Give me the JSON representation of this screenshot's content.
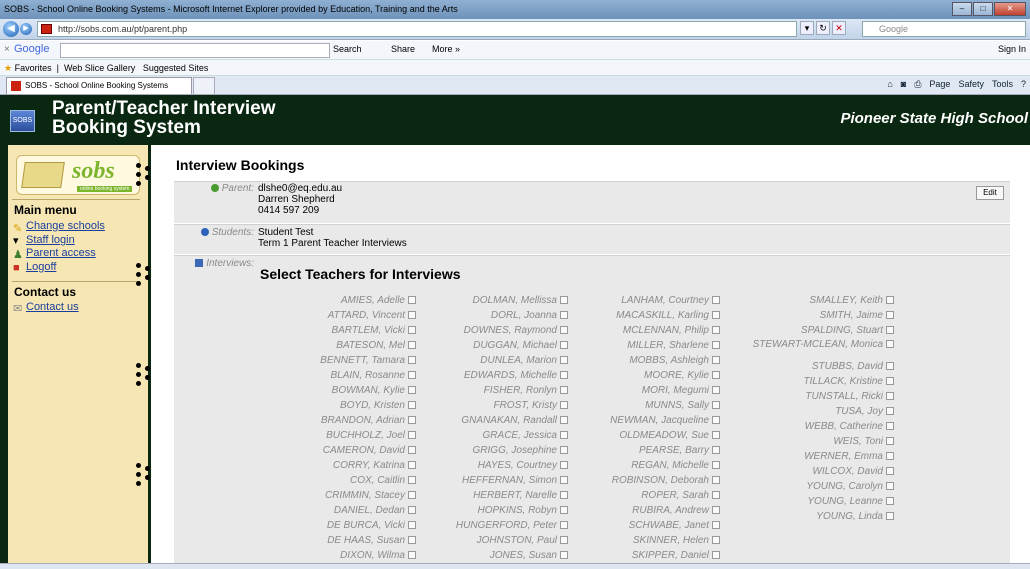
{
  "browser": {
    "window_title": "SOBS - School Online Booking Systems - Microsoft Internet Explorer provided by Education, Training and the Arts",
    "url": "http://sobs.com.au/pt/parent.php",
    "search_placeholder": "Google",
    "google_bar": {
      "brand": "Google",
      "search": "Search",
      "share": "Share",
      "more": "More »",
      "sign_in": "Sign In"
    },
    "favorites": {
      "label": "Favorites",
      "web_slice": "Web Slice Gallery",
      "suggested": "Suggested Sites"
    },
    "tab_title": "SOBS - School Online Booking Systems",
    "commands": [
      "Page",
      "Safety",
      "Tools"
    ]
  },
  "header": {
    "title_line1": "Parent/Teacher Interview",
    "title_line2": "Booking System",
    "school": "Pioneer State High School",
    "logo_text": "SOBS"
  },
  "sidebar": {
    "brand": "sobs",
    "brand_tag": "online booking system",
    "main_menu_heading": "Main menu",
    "main_menu": [
      "Change schools",
      "Staff login",
      "Parent access",
      "Logoff"
    ],
    "contact_heading": "Contact us",
    "contact_links": [
      "Contact us"
    ]
  },
  "main": {
    "page_title": "Interview Bookings",
    "parent": {
      "label": "Parent:",
      "email": "dlshe0@eq.edu.au",
      "name": "Darren Shepherd",
      "phone": "0414 597 209",
      "edit_label": "Edit"
    },
    "students": {
      "label": "Students:",
      "name": "Student Test",
      "event": "Term 1 Parent Teacher Interviews"
    },
    "interviews": {
      "label": "Interviews:",
      "heading": "Select Teachers for Interviews"
    },
    "teacher_columns": [
      [
        "AMIES, Adelle",
        "ATTARD, Vincent",
        "BARTLEM, Vicki",
        "BATESON, Mel",
        "BENNETT, Tamara",
        "BLAIN, Rosanne",
        "BOWMAN, Kylie",
        "BOYD, Kristen",
        "BRANDON, Adrian",
        "BUCHHOLZ, Joel",
        "CAMERON, David",
        "CORRY, Katrina",
        "COX, Caitlin",
        "CRIMMIN, Stacey",
        "DANIEL, Dedan",
        "DE BURCA, Vicki",
        "DE HAAS, Susan",
        "DIXON, Wilma"
      ],
      [
        "DOLMAN, Mellissa",
        "DORL, Joanna",
        "DOWNES, Raymond",
        "DUGGAN, Michael",
        "DUNLEA, Marion",
        "EDWARDS, Michelle",
        "FISHER, Ronlyn",
        "FROST, Kristy",
        "GNANAKAN, Randall",
        "GRACE, Jessica",
        "GRIGG, Josephine",
        "HAYES, Courtney",
        "HEFFERNAN, Simon",
        "HERBERT, Narelle",
        "HOPKINS, Robyn",
        "HUNGERFORD, Peter",
        "JOHNSTON, Paul",
        "JONES, Susan"
      ],
      [
        "LANHAM, Courtney",
        "MACASKILL, Karling",
        "MCLENNAN, Philip",
        "MILLER, Sharlene",
        "MOBBS, Ashleigh",
        "MOORE, Kylie",
        "MORI, Megumi",
        "MUNNS, Sally",
        "NEWMAN, Jacqueline",
        "OLDMEADOW, Sue",
        "PEARSE, Barry",
        "REGAN, Michelle",
        "ROBINSON, Deborah",
        "ROPER, Sarah",
        "RUBIRA, Andrew",
        "SCHWABE, Janet",
        "SKINNER, Helen",
        "SKIPPER, Daniel"
      ],
      [
        "SMALLEY, Keith",
        "SMITH, Jaime",
        "SPALDING, Stuart",
        "STEWART-MCLEAN, Monica",
        "STUBBS, David",
        "TILLACK, Kristine",
        "TUNSTALL, Ricki",
        "TUSA, Joy",
        "WEBB, Catherine",
        "WEIS, Toni",
        "WERNER, Emma",
        "WILCOX, David",
        "YOUNG, Carolyn",
        "YOUNG, Leanne",
        "YOUNG, Linda"
      ]
    ]
  }
}
